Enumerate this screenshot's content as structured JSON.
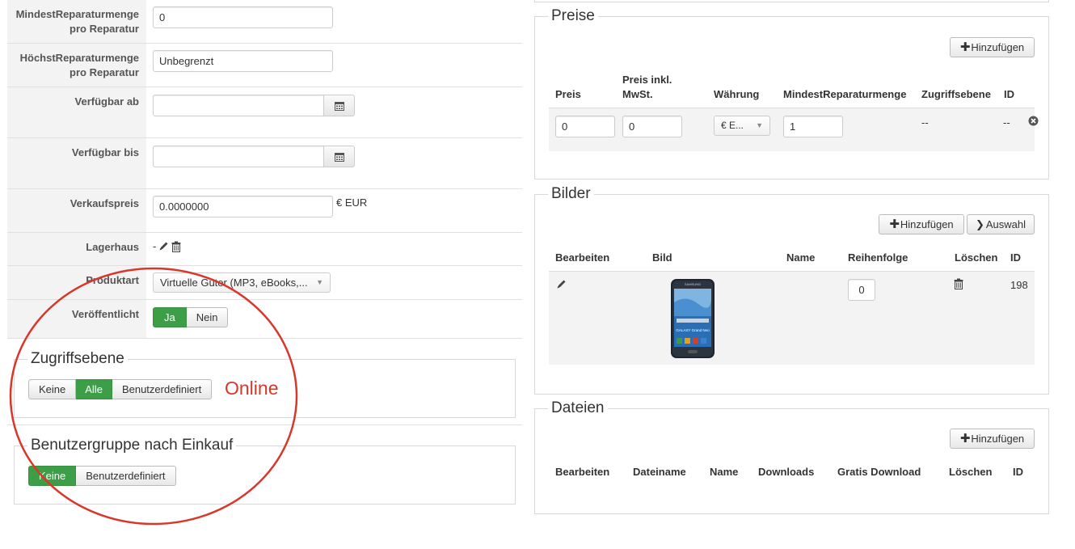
{
  "form": {
    "min_repair": {
      "label": "MindestReparaturmenge pro Reparatur",
      "value": "0"
    },
    "max_repair": {
      "label": "HöchstReparaturmenge pro Reparatur",
      "value": "Unbegrenzt"
    },
    "available_from": {
      "label": "Verfügbar ab",
      "value": ""
    },
    "available_to": {
      "label": "Verfügbar bis",
      "value": ""
    },
    "price": {
      "label": "Verkaufspreis",
      "value": "0.0000000",
      "currency": "€ EUR"
    },
    "warehouse": {
      "label": "Lagerhaus",
      "value": "-"
    },
    "product_type": {
      "label": "Produktart",
      "value": "Virtuelle Güter (MP3, eBooks,..."
    },
    "published": {
      "label": "Veröffentlicht",
      "options": [
        "Ja",
        "Nein"
      ],
      "active": "Ja"
    }
  },
  "access": {
    "legend": "Zugriffsebene",
    "options": [
      "Keine",
      "Alle",
      "Benutzerdefiniert"
    ],
    "active": "Alle",
    "annotation": "Online"
  },
  "usergroup": {
    "legend": "Benutzergruppe nach Einkauf",
    "options": [
      "Keine",
      "Benutzerdefiniert"
    ],
    "active": "Keine"
  },
  "prices": {
    "legend": "Preise",
    "add_label": "Hinzufügen",
    "headers": [
      "Preis",
      "Preis inkl.\nMwSt.",
      "Währung",
      "MindestReparaturmenge",
      "Zugriffsebene",
      "ID"
    ],
    "row": {
      "price": "0",
      "price_incl": "0",
      "currency": "€ E...",
      "min_qty": "1",
      "access": "--",
      "id": "--"
    }
  },
  "images": {
    "legend": "Bilder",
    "add_label": "Hinzufügen",
    "select_label": "Auswahl",
    "headers": [
      "Bearbeiten",
      "Bild",
      "Name",
      "Reihenfolge",
      "Löschen",
      "ID"
    ],
    "row": {
      "order": "0",
      "id": "198",
      "phone_brand": "SAMSUNG",
      "phone_model": "GALAXY Grand Neo"
    }
  },
  "files": {
    "legend": "Dateien",
    "add_label": "Hinzufügen",
    "headers": [
      "Bearbeiten",
      "Dateiname",
      "Name",
      "Downloads",
      "Gratis Download",
      "Löschen",
      "ID"
    ]
  },
  "colors": {
    "active_green": "#3d9e48",
    "annotation_red": "#d9372a",
    "label_bg": "#f3f3f3"
  }
}
